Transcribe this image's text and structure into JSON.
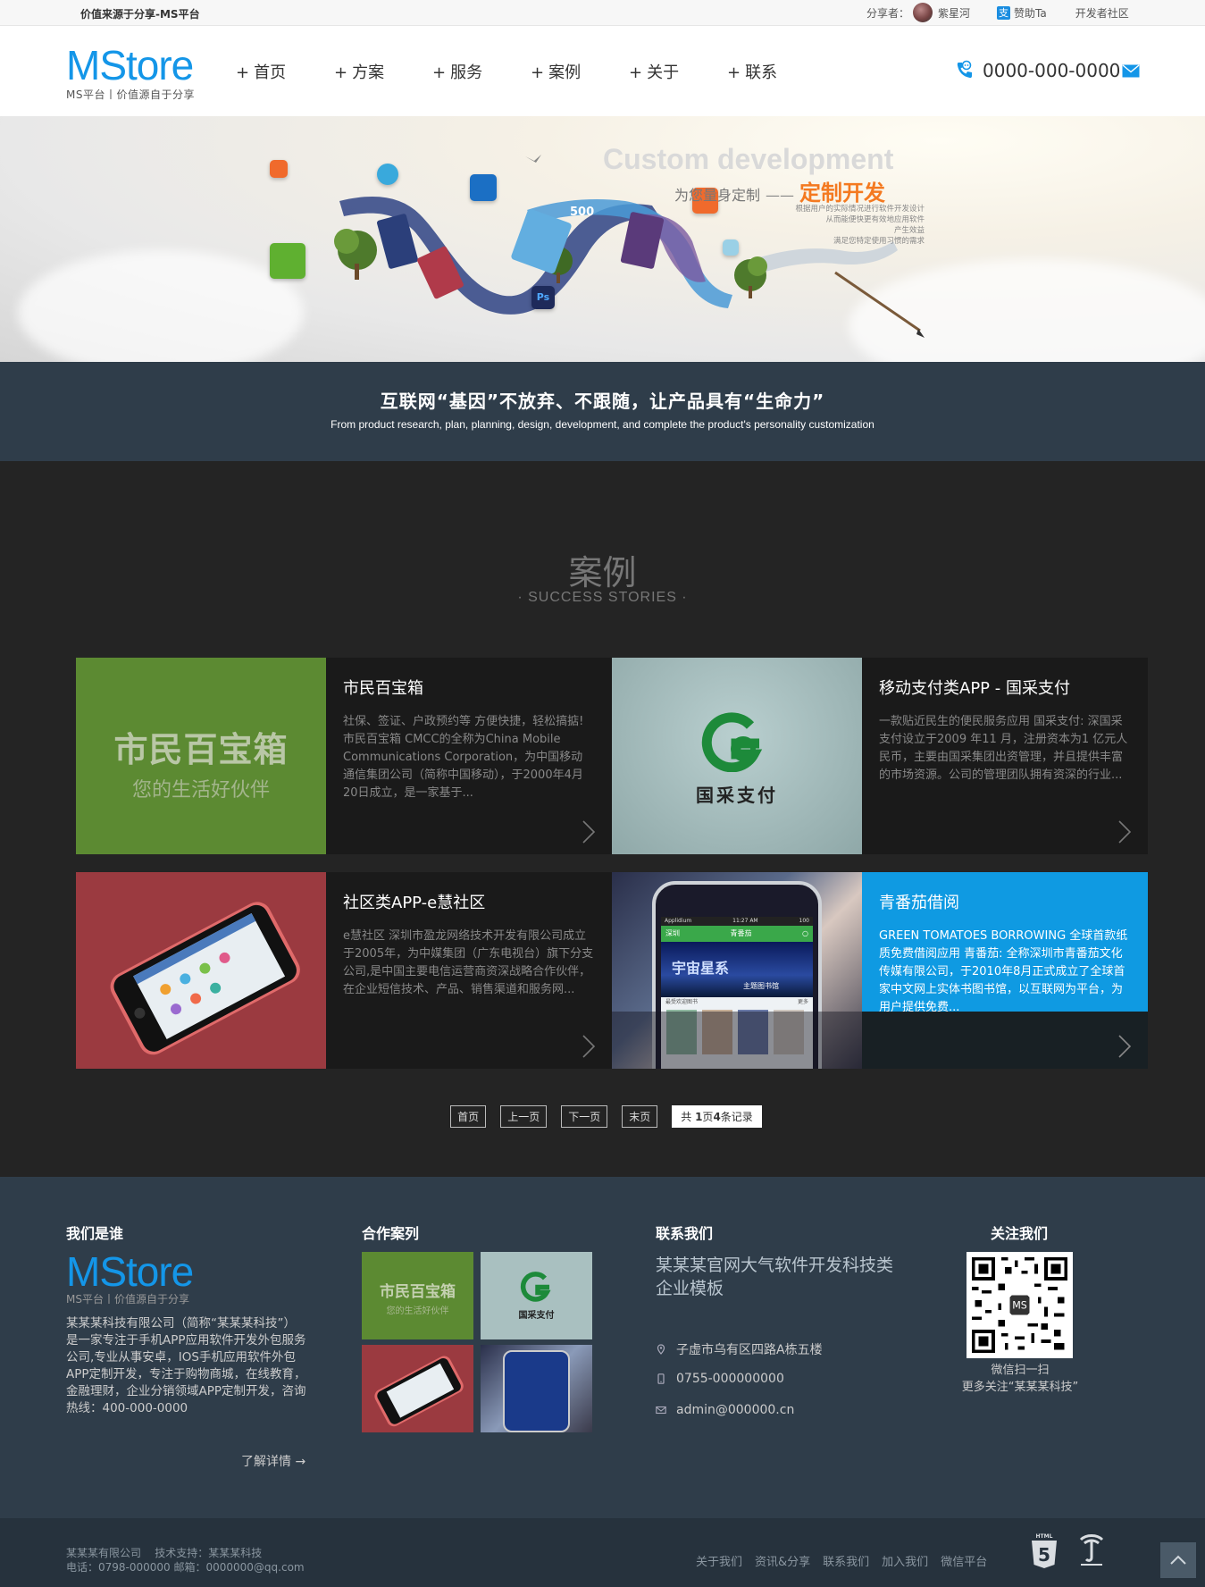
{
  "topbar": {
    "tagline": "价值来源于分享-MS平台",
    "sharer_label": "分享者：",
    "sharer_name": "紫星河",
    "alipay_glyph": "支",
    "donate": "赞助Ta",
    "community": "开发者社区"
  },
  "brand": {
    "logo": "MStore",
    "logo_sub": "MS平台丨价值源自于分享",
    "accent": "#1496e8"
  },
  "nav": {
    "items": [
      {
        "plus": "+",
        "label": "首页"
      },
      {
        "plus": "+",
        "label": "方案"
      },
      {
        "plus": "+",
        "label": "服务"
      },
      {
        "plus": "+",
        "label": "案例"
      },
      {
        "plus": "+",
        "label": "关于"
      },
      {
        "plus": "+",
        "label": "联系"
      }
    ],
    "phone": "0000-000-0000"
  },
  "banner": {
    "title_en": "Custom development",
    "title_cn": "为您量身定制",
    "dash": "——",
    "title_hl": "定制开发",
    "desc": [
      "根据用户的实际情况进行软件开发设计",
      "从而能便快更有效地应用软件",
      "产生效益",
      "满足您特定使用习惯的需求"
    ],
    "ps_glyph": "Ps",
    "kcal": "500"
  },
  "slogan": {
    "cn": "互联网“基因”不放弃、不跟随，让产品具有“生命力”",
    "en": "From product research, plan, planning, design, development, and complete the product's personality customization"
  },
  "cases": {
    "title": "案例",
    "subtitle": "· SUCCESS STORIES ·",
    "items": [
      {
        "title": "市民百宝箱",
        "desc": "社保、签证、户政预约等 方便快捷，轻松搞掂! 市民百宝箱 CMCC的全称为China Mobile Communications Corporation，为中国移动通信集团公司（简称中国移动），于2000年4月20日成立，是一家基于...",
        "thumb_title": "市民百宝箱",
        "thumb_sub": "您的生活好伙伴"
      },
      {
        "title": "移动支付类APP - 国采支付",
        "desc": "一款贴近民生的便民服务应用 国采支付: 深国采支付设立于2009 年11 月，注册资本为1 亿元人民币，主要由国采集团出资管理，并且提供丰富的市场资源。公司的管理团队拥有资深的行业...",
        "thumb_title": "国采支付"
      },
      {
        "title": "社区类APP-e慧社区",
        "desc": "e慧社区 深圳市盈龙网络技术开发有限公司成立于2005年，为中媒集团（广东电视台）旗下分支公司,是中国主要电信运营商资深战略合作伙伴，在企业短信技术、产品、销售渠道和服务网..."
      },
      {
        "title": "青番茄借阅",
        "desc": "GREEN TOMATOES BORROWING 全球首款纸质免费借阅应用 青番茄: 全称深圳市青番茄文化传媒有限公司，于2010年8月正式成立了全球首家中文网上实体书图书馆，以互联网为平台，为用户提供免费...",
        "phone_carrier": "Applidium",
        "phone_time": "11:27 AM",
        "phone_battery": "100",
        "phone_city": "深圳",
        "phone_app": "青番茄",
        "phone_banner": "宇宙星系",
        "phone_banner_sub": "主题图书馆",
        "phone_section": "最受欢迎图书",
        "phone_more": "更多"
      }
    ]
  },
  "pager": {
    "first": "首页",
    "prev": "上一页",
    "next": "下一页",
    "last": "末页",
    "total_prefix": "共 ",
    "total_page": "1",
    "total_mid": "页",
    "total_count": "4",
    "total_suffix": "条记录"
  },
  "footer": {
    "about_title": "我们是谁",
    "about_text": "某某某科技有限公司（简称“某某某科技”）是一家专注于手机APP应用软件开发外包服务公司,专业从事安卓，IOS手机应用软件外包APP定制开发，专注于购物商城，在线教育，金融理财，企业分销领域APP定制开发，咨询热线：400-000-0000",
    "more": "了解详情 →",
    "cases_title": "合作案列",
    "contact_title": "联系我们",
    "contact_heading": "某某某官网大气软件开发科技类企业模板",
    "address": "子虚市乌有区四路A栋五楼",
    "phone": "0755-000000000",
    "email": "admin@000000.cn",
    "follow_title": "关注我们",
    "qr_center": "MS",
    "qr_caption1": "微信扫一扫",
    "qr_caption2": "更多关注“某某某科技”"
  },
  "bottom": {
    "copy1": "某某某有限公司    技术支持：某某某科技",
    "copy2": "电话：0798-000000 邮箱：0000000@qq.com",
    "links": [
      "关于我们",
      "资讯&分享",
      "联系我们",
      "加入我们",
      "微信平台"
    ],
    "html5_label": "HTML",
    "html5_digit": "5"
  }
}
